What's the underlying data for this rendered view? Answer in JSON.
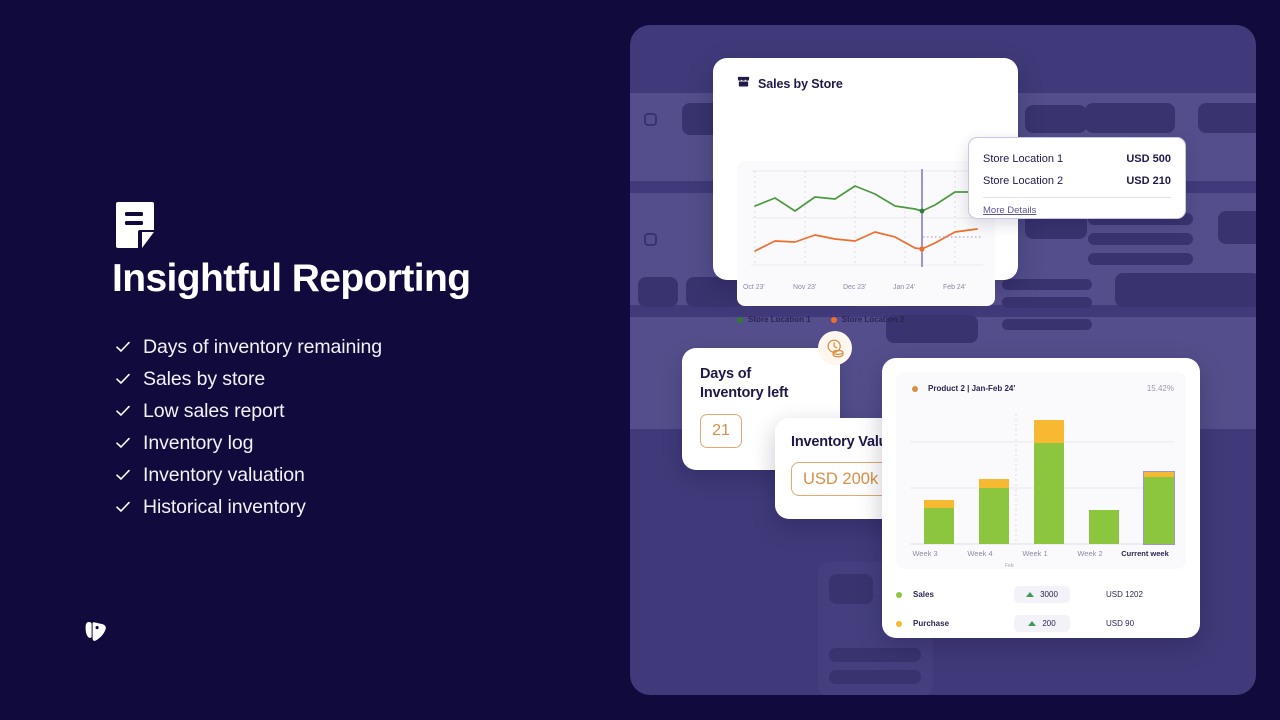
{
  "hero": {
    "icon": "report-document-icon",
    "title": "Insightful Reporting",
    "features": [
      "Days of inventory remaining",
      "Sales by store",
      "Low sales report",
      "Inventory log",
      "Inventory valuation",
      "Historical inventory"
    ]
  },
  "brand": {
    "logo_icon": "zoho-inventory-logo"
  },
  "colors": {
    "background": "#110A3C",
    "panel": "#403A7A",
    "panel_band": "#544E8C",
    "skeleton": "#39336F",
    "accent_orange": "#D98F45",
    "series_green": "#4C9A3F",
    "series_orange": "#EE6E2B",
    "bar_sales": "#8CC63E",
    "bar_purchase": "#F6B931",
    "delta_up": "#3E9A57"
  },
  "sales_card": {
    "icon": "storefront-icon",
    "title": "Sales by Store",
    "legend": [
      {
        "label": "Store Location 1",
        "color": "#2E7D32"
      },
      {
        "label": "Store Location 2",
        "color": "#EE6E2B"
      }
    ]
  },
  "tooltip": {
    "rows": [
      {
        "label": "Store Location 1",
        "value": "USD 500"
      },
      {
        "label": "Store Location 2",
        "value": "USD 210"
      }
    ],
    "more_details_link": "More Details"
  },
  "days_card": {
    "title_line1": "Days of",
    "title_line2": "Inventory left",
    "value": "21",
    "badge_icon": "clock-coins-icon"
  },
  "inventory_value_card": {
    "title": "Inventory Value",
    "value": "USD 200k"
  },
  "product_card": {
    "product_label": "Product 2 | Jan-Feb 24'",
    "percent": "15.42%",
    "month_divider_label": "Feb",
    "rows": [
      {
        "name": "Sales",
        "color": "#8CC63E",
        "delta": "3000",
        "amount": "USD 1202",
        "direction": "up"
      },
      {
        "name": "Purchase",
        "color": "#F6B931",
        "delta": "200",
        "amount": "USD 90",
        "direction": "up"
      }
    ]
  },
  "chart_data": [
    {
      "type": "line",
      "title": "Sales by Store",
      "xlabel": "",
      "ylabel": "",
      "x": [
        "Oct 23'",
        "Nov 23'",
        "Dec 23'",
        "Jan 24'",
        "Feb 24'"
      ],
      "tick_labels": [
        "Oct 23'",
        "Nov 23'",
        "Dec 23'",
        "Jan 24'",
        "Feb 24'"
      ],
      "grid": true,
      "legend_position": "bottom-left",
      "highlight_x": "mid Jan 24'",
      "series": [
        {
          "name": "Store Location 1",
          "color": "#4C9A3F",
          "values": [
            66,
            74,
            63,
            78,
            76,
            90,
            83,
            70,
            65,
            62,
            70,
            81,
            80
          ]
        },
        {
          "name": "Store Location 2",
          "color": "#EE6E2B",
          "values": [
            20,
            33,
            31,
            40,
            35,
            33,
            43,
            38,
            26,
            25,
            33,
            44,
            47
          ]
        }
      ],
      "annotations": [
        {
          "label": "Store Location 1",
          "value": "USD 500"
        },
        {
          "label": "Store Location 2",
          "value": "USD 210"
        }
      ]
    },
    {
      "type": "bar",
      "subtype": "stacked",
      "title": "Product 2 | Jan-Feb 24'",
      "percent_label": "15.42%",
      "categories": [
        "Week 3",
        "Week 4",
        "Week 1",
        "Week 2",
        "Current week"
      ],
      "xlabel": "",
      "ylabel": "",
      "ylim": [
        0,
        100
      ],
      "grid": true,
      "legend_position": "bottom",
      "series": [
        {
          "name": "Sales",
          "color": "#8CC63E",
          "values": [
            28,
            43,
            78,
            26,
            52
          ]
        },
        {
          "name": "Purchase",
          "color": "#F6B931",
          "values": [
            6,
            7,
            17,
            0,
            4
          ]
        }
      ],
      "summary": [
        {
          "name": "Sales",
          "delta": "3000",
          "amount": "USD 1202"
        },
        {
          "name": "Purchase",
          "delta": "200",
          "amount": "USD 90"
        }
      ]
    }
  ]
}
